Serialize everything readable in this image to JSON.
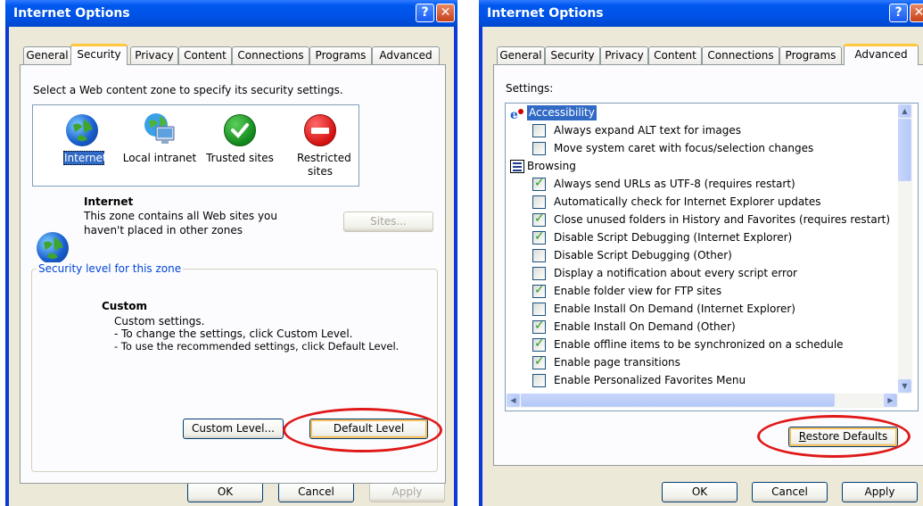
{
  "left": {
    "title": "Internet Options",
    "tabs": [
      "General",
      "Security",
      "Privacy",
      "Content",
      "Connections",
      "Programs",
      "Advanced"
    ],
    "active_tab": "Security",
    "instruction": "Select a Web content zone to specify its security settings.",
    "zones": [
      {
        "label": "Internet",
        "icon": "globe-icon",
        "selected": true
      },
      {
        "label": "Local intranet",
        "icon": "local-intranet-icon"
      },
      {
        "label": "Trusted sites",
        "icon": "checkmark-icon"
      },
      {
        "label": "Restricted sites",
        "icon": "no-entry-icon"
      }
    ],
    "zone_title": "Internet",
    "zone_desc_1": "This zone contains all Web sites you",
    "zone_desc_2": "haven't placed in other zones",
    "sites_button": "Sites...",
    "group_label": "Security level for this zone",
    "level_title": "Custom",
    "level_line_1": "Custom settings.",
    "level_line_2": "- To change the settings, click Custom Level.",
    "level_line_3": "- To use the recommended settings, click Default Level.",
    "custom_level_button": "Custom Level...",
    "default_level_button": "Default Level",
    "ok_button": "OK",
    "cancel_button": "Cancel",
    "apply_button": "Apply"
  },
  "right": {
    "title": "Internet Options",
    "tabs": [
      "General",
      "Security",
      "Privacy",
      "Content",
      "Connections",
      "Programs",
      "Advanced"
    ],
    "active_tab": "Advanced",
    "settings_label": "Settings:",
    "categories": {
      "accessibility": "Accessibility",
      "browsing": "Browsing"
    },
    "items": [
      {
        "label": "Always expand ALT text for images",
        "checked": false
      },
      {
        "label": "Move system caret with focus/selection changes",
        "checked": false
      },
      {
        "label": "Always send URLs as UTF-8 (requires restart)",
        "checked": true
      },
      {
        "label": "Automatically check for Internet Explorer updates",
        "checked": false
      },
      {
        "label": "Close unused folders in History and Favorites (requires restart)",
        "checked": true
      },
      {
        "label": "Disable Script Debugging (Internet Explorer)",
        "checked": true
      },
      {
        "label": "Disable Script Debugging (Other)",
        "checked": false
      },
      {
        "label": "Display a notification about every script error",
        "checked": false
      },
      {
        "label": "Enable folder view for FTP sites",
        "checked": true
      },
      {
        "label": "Enable Install On Demand (Internet Explorer)",
        "checked": false
      },
      {
        "label": "Enable Install On Demand (Other)",
        "checked": true
      },
      {
        "label": "Enable offline items to be synchronized on a schedule",
        "checked": true
      },
      {
        "label": "Enable page transitions",
        "checked": true
      },
      {
        "label": "Enable Personalized Favorites Menu",
        "checked": false
      }
    ],
    "restore_button": "Restore Defaults",
    "ok_button": "OK",
    "cancel_button": "Cancel",
    "apply_button": "Apply"
  },
  "colors": {
    "titlebar": "#0052e6",
    "face": "#ece9d8",
    "accent": "#0046d5",
    "highlight_ring": "#e01818"
  }
}
